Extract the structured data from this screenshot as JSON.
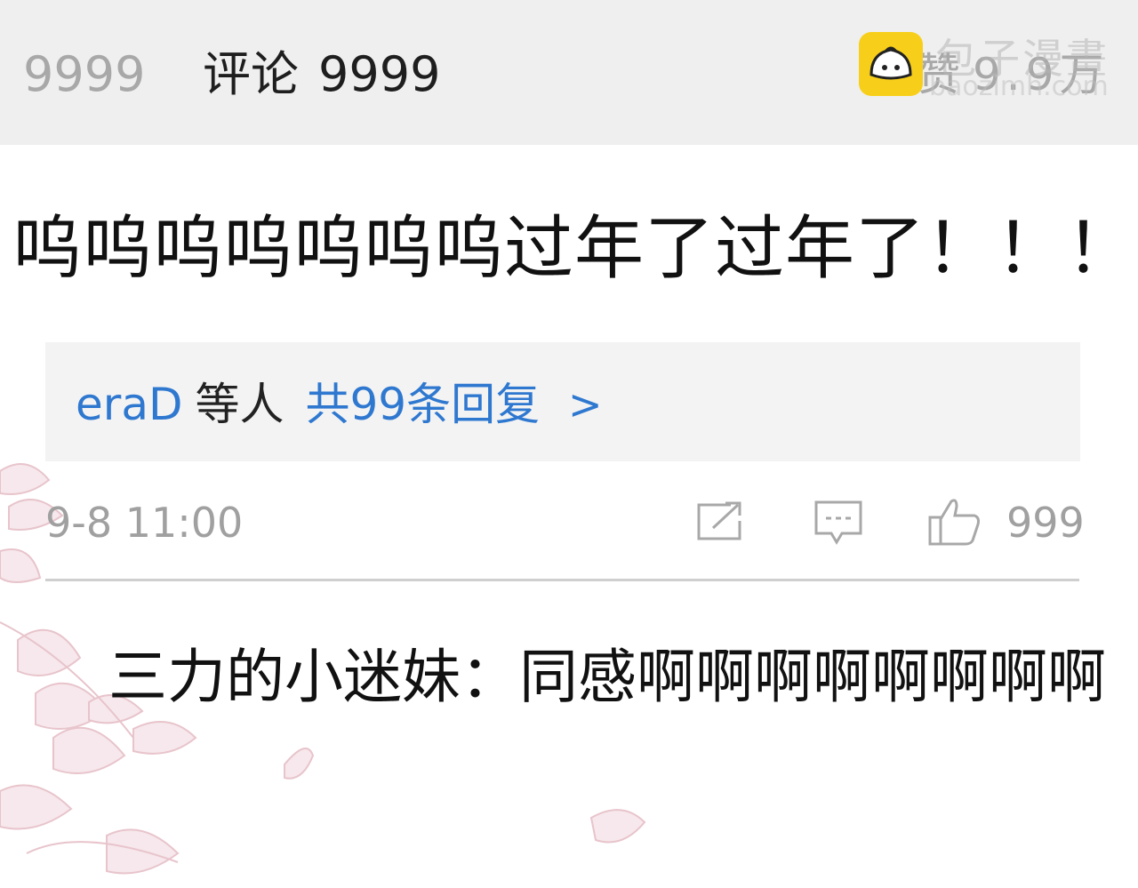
{
  "header": {
    "left_count": "9999",
    "comments_label": "评论",
    "comments_count": "9999",
    "likes_label": "赞",
    "likes_count": "9.9万"
  },
  "watermark": {
    "brand": "包子漫畫",
    "url": "baozimh.com",
    "icon": "bun-logo-icon"
  },
  "comment": {
    "text": "呜呜呜呜呜呜呜过年了过年了！！！"
  },
  "replies_summary": {
    "user": "eraD",
    "mid": "等人",
    "count_text": "共99条回复",
    "arrow": ">"
  },
  "meta": {
    "time": "9-8 11:00",
    "icons": [
      "share-icon",
      "comment-icon",
      "thumbs-up-icon"
    ],
    "like_count": "999"
  },
  "reply": {
    "text": "三力的小迷妹：同感啊啊啊啊啊啊啊啊"
  },
  "colors": {
    "header_bg": "#efefef",
    "link_blue": "#2f78d0",
    "muted_gray": "#a0a0a0",
    "watermark_yellow": "#f7cf1a",
    "flower_pink": "#e8c4cc"
  }
}
